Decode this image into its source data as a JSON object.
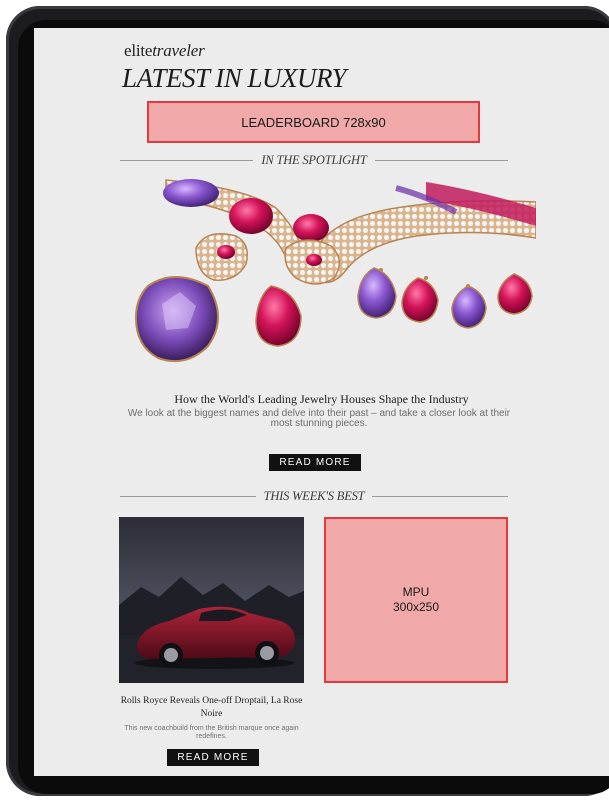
{
  "brand": {
    "name_regular": "elite",
    "name_italic": "traveler"
  },
  "headline": "LATEST IN LUXURY",
  "ads": {
    "leaderboard": "LEADERBOARD 728x90",
    "mpu_line1": "MPU",
    "mpu_line2": "300x250"
  },
  "spotlight": {
    "section_label": "IN THE SPOTLIGHT",
    "title": "How the World's Leading Jewelry Houses Shape the Industry",
    "description": "We look at the biggest names and delve into their past – and take a closer look at their most stunning pieces.",
    "button": "READ MORE"
  },
  "best": {
    "section_label": "THIS WEEK'S BEST",
    "card_title": "Rolls Royce Reveals One-off Droptail, La Rose Noire",
    "card_desc": "This new coachbuild from the British marque once again redefines.",
    "button": "READ MORE"
  },
  "colors": {
    "ad_fill": "#f0a8a8",
    "ad_border": "#e03a3a",
    "button_bg": "#111111",
    "screen_bg": "#ececec"
  }
}
